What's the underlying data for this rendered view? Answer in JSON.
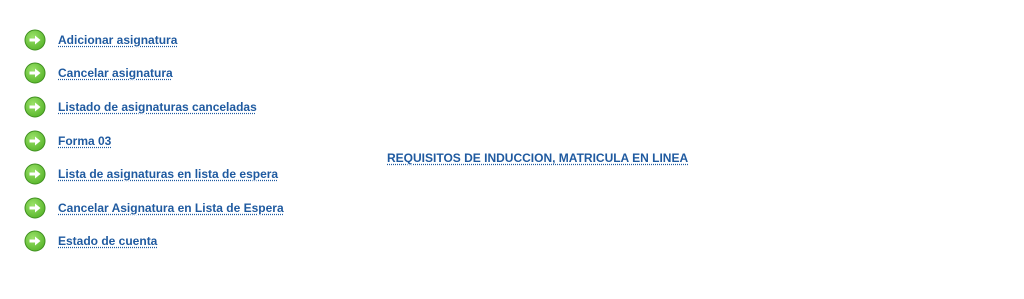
{
  "menu": {
    "items": [
      {
        "label": "Adicionar asignatura",
        "icon": "arrow-right-circle-icon"
      },
      {
        "label": "Cancelar asignatura",
        "icon": "arrow-right-circle-icon"
      },
      {
        "label": "Listado de asignaturas canceladas",
        "icon": "arrow-right-circle-icon"
      },
      {
        "label": "Forma 03",
        "icon": "arrow-right-circle-icon"
      },
      {
        "label": "Lista de asignaturas en lista de espera",
        "icon": "arrow-right-circle-icon"
      },
      {
        "label": "Cancelar Asignatura en Lista de Espera",
        "icon": "arrow-right-circle-icon"
      },
      {
        "label": "Estado de cuenta",
        "icon": "arrow-right-circle-icon"
      }
    ]
  },
  "center": {
    "link_label": "REQUISITOS DE INDUCCION, MATRICULA EN LINEA"
  },
  "colors": {
    "link": "#1f5aa0",
    "icon_green": "#5cb82e"
  }
}
